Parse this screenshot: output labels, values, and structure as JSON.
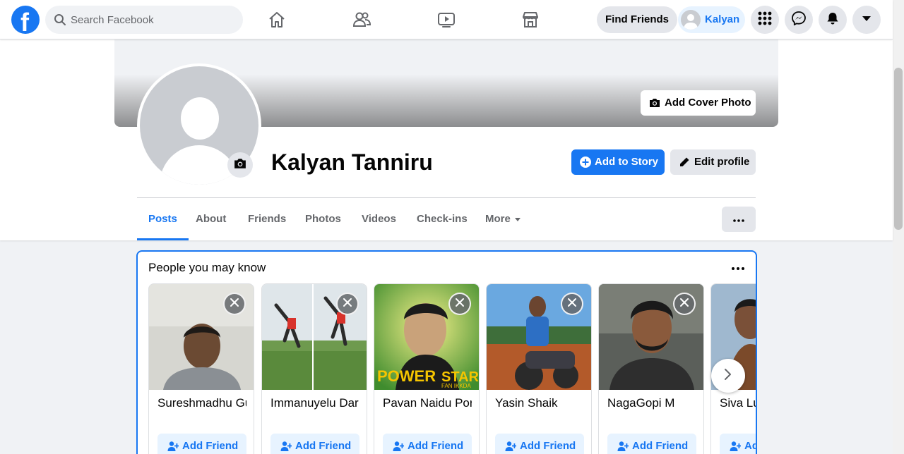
{
  "topbar": {
    "logo_letter": "f",
    "search_placeholder": "Search Facebook",
    "find_friends_label": "Find Friends",
    "profile_name": "Kalyan"
  },
  "profile": {
    "name": "Kalyan Tanniru",
    "add_cover_label": "Add Cover Photo",
    "add_story_label": "Add to Story",
    "edit_profile_label": "Edit profile"
  },
  "tabs": [
    {
      "label": "Posts",
      "active": true
    },
    {
      "label": "About"
    },
    {
      "label": "Friends"
    },
    {
      "label": "Photos"
    },
    {
      "label": "Videos"
    },
    {
      "label": "Check-ins"
    },
    {
      "label": "More"
    }
  ],
  "pymk": {
    "title": "People you may know",
    "add_friend_label": "Add Friend",
    "people": [
      {
        "name": "Sureshmadhu Gu"
      },
      {
        "name": "Immanuyelu Dar"
      },
      {
        "name": "Pavan Naidu Por"
      },
      {
        "name": "Yasin Shaik"
      },
      {
        "name": "NagaGopi M"
      },
      {
        "name": "Siva Lu"
      }
    ],
    "poster_text_1": "POWER",
    "poster_text_2": "STAR",
    "poster_text_3": "FAN IKKDA"
  },
  "colors": {
    "brand": "#1877f2",
    "button_grey": "#e4e6eb",
    "light_blue": "#e7f3ff"
  }
}
